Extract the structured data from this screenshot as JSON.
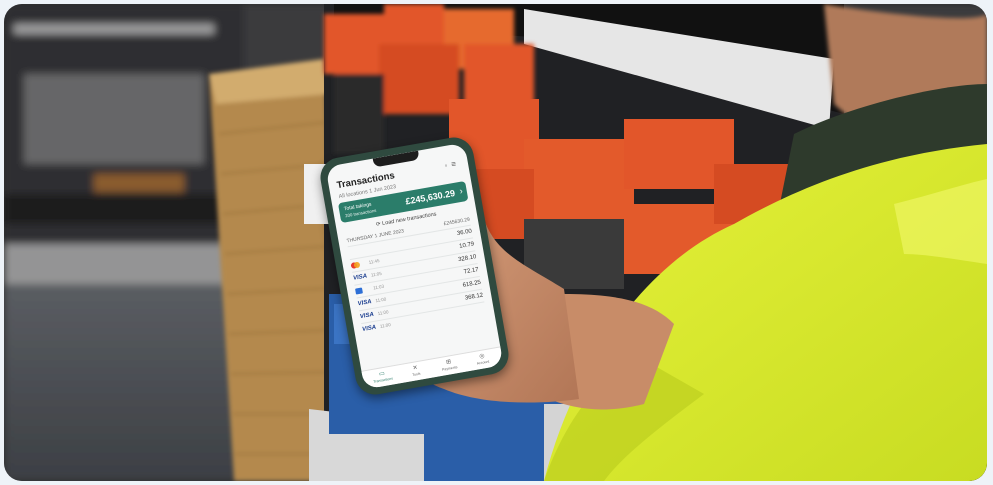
{
  "screen": {
    "title": "Transactions",
    "header_icons": [
      "user-icon",
      "filter-icon"
    ],
    "filter_text": "All locations  1 Jun 2023",
    "total_card": {
      "label": "Total takings",
      "sub_label": "200 transactions",
      "amount": "£245,630.29",
      "arrow": "›"
    },
    "load_new_label": "⟳  Load new transactions",
    "date_group": {
      "label": "THURSDAY 1 JUNE 2023",
      "amount": "£245630.29"
    },
    "transactions": [
      {
        "logo": "none",
        "time": "",
        "value": "36.00"
      },
      {
        "logo": "mastercard",
        "time": "11:45",
        "value": "10.79"
      },
      {
        "logo": "visa",
        "time": "11:05",
        "value": "328.10"
      },
      {
        "logo": "amex",
        "time": "11:03",
        "value": "72.17"
      },
      {
        "logo": "visa",
        "time": "11:00",
        "value": "618.25"
      },
      {
        "logo": "visa",
        "time": "11:00",
        "value": "368.12"
      },
      {
        "logo": "visa",
        "time": "11:00",
        "value": ""
      }
    ],
    "tabs": [
      {
        "icon": "card-reader-icon",
        "label": "Transactions",
        "active": true
      },
      {
        "icon": "tools-icon",
        "label": "Tools",
        "active": false
      },
      {
        "icon": "plus-icon",
        "label": "Payments",
        "active": false
      },
      {
        "icon": "account-icon",
        "label": "Account",
        "active": false
      }
    ]
  },
  "colors": {
    "accent": "#2b7d6a",
    "hi_vis_vest": "#d9ec2a",
    "product_boxes": "#e2562a",
    "phone_case": "#2f4a3f"
  }
}
